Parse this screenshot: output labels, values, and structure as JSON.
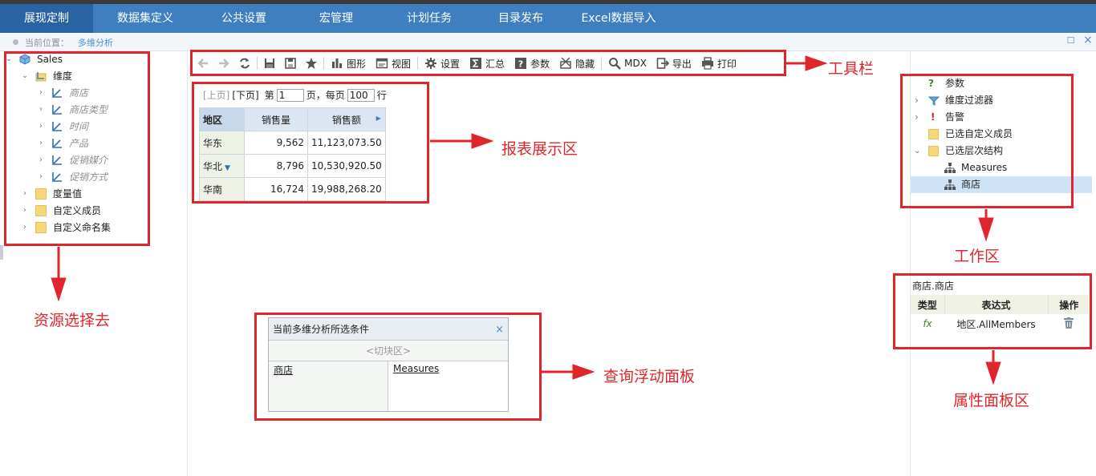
{
  "nav": {
    "tabs": [
      "展现定制",
      "数据集定义",
      "公共设置",
      "宏管理",
      "计划任务",
      "目录发布",
      "Excel数据导入"
    ],
    "active": 0
  },
  "crumb": {
    "label": "当前位置：",
    "current": "多维分析"
  },
  "window_controls": {
    "maximize": "☐",
    "close": "×"
  },
  "tree": {
    "root": "Sales",
    "dim_folder": "维度",
    "dims": [
      "商店",
      "商店类型",
      "时间",
      "产品",
      "促销媒介",
      "促销方式"
    ],
    "folders": [
      "度量值",
      "自定义成员",
      "自定义命名集"
    ]
  },
  "toolbar": {
    "figure": "图形",
    "view": "视图",
    "settings": "设置",
    "summary": "汇总",
    "params": "参数",
    "hide": "隐藏",
    "mdx": "MDX",
    "export": "导出",
    "print": "打印"
  },
  "pager": {
    "prev": "[上页]",
    "next": "[下页]",
    "page_pre": "第",
    "page_value": "1",
    "page_post": "页，每页",
    "size_value": "100",
    "size_post": "行"
  },
  "report": {
    "headers": [
      "地区",
      "销售量",
      "销售额"
    ],
    "rows": [
      {
        "region": "华东",
        "qty": "9,562",
        "amount": "11,123,073.50"
      },
      {
        "region": "华北",
        "qty": "8,796",
        "amount": "10,530,920.50"
      },
      {
        "region": "华南",
        "qty": "16,724",
        "amount": "19,988,268.20"
      }
    ]
  },
  "float_panel": {
    "title": "当前多维分析所选条件",
    "close": "×",
    "slice": "<切块区>",
    "rows_field": "商店",
    "cols_field": "Measures"
  },
  "workspace": {
    "params": "参数",
    "filter": "维度过滤器",
    "alert": "告警",
    "custom_members": "已选自定义成员",
    "hierarchy": "已选层次结构",
    "h1": "Measures",
    "h2": "商店"
  },
  "props": {
    "title": "商店.商店",
    "headers": [
      "类型",
      "表达式",
      "操作"
    ],
    "row": {
      "type": "fx",
      "expr": "地区.AllMembers"
    }
  },
  "callouts": {
    "toolbar": "工具栏",
    "report": "报表展示区",
    "workspace": "工作区",
    "resource": "资源选择去",
    "query": "查询浮动面板",
    "props": "属性面板区"
  },
  "colors": {
    "nav_bg": "#3f7fc0",
    "nav_active": "#2a63a3",
    "annotation": "#e0262d",
    "accent_blue": "#4a8fd6"
  }
}
